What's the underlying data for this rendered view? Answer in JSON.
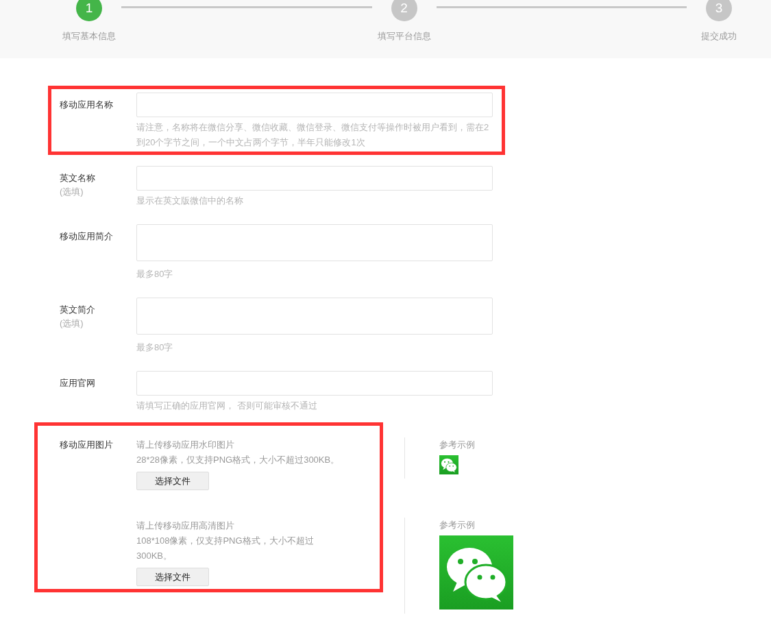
{
  "steps": [
    {
      "number": "1",
      "label": "填写基本信息",
      "selected": true
    },
    {
      "number": "2",
      "label": "填写平台信息",
      "selected": false
    },
    {
      "number": "3",
      "label": "提交成功",
      "selected": false
    }
  ],
  "fields": [
    {
      "label": "移动应用名称",
      "kind": "input",
      "highlighted": true,
      "hint": "请注意，名称将在微信分享、微信收藏、微信登录、微信支付等操作时被用户看到，需在2到20个字节之间，一个中文占两个字节，半年只能修改1次"
    },
    {
      "label": "英文名称",
      "note": "(选填)",
      "kind": "input",
      "highlighted": false,
      "hint": "显示在英文版微信中的名称"
    },
    {
      "label": "移动应用简介",
      "kind": "textarea",
      "highlighted": false,
      "hint": "最多80字"
    },
    {
      "label": "英文简介",
      "note": "(选填)",
      "kind": "textarea",
      "highlighted": false,
      "hint": "最多80字"
    },
    {
      "label": "应用官网",
      "kind": "input",
      "highlighted": false,
      "hint": "请填写正确的应用官网， 否则可能审核不通过"
    }
  ],
  "image_section": {
    "label": "移动应用图片",
    "highlighted": true,
    "uploads": [
      {
        "title": "请上传移动应用水印图片",
        "detail": "28*28像素，仅支持PNG格式，大小不超过300KB。",
        "button": "选择文件",
        "reference_label": "参考示例",
        "kind": "small"
      },
      {
        "title": "请上传移动应用高清图片",
        "detail": "108*108像素，仅支持PNG格式，大小不超过300KB。",
        "button": "选择文件",
        "reference_label": "参考示例",
        "kind": "large"
      }
    ]
  }
}
